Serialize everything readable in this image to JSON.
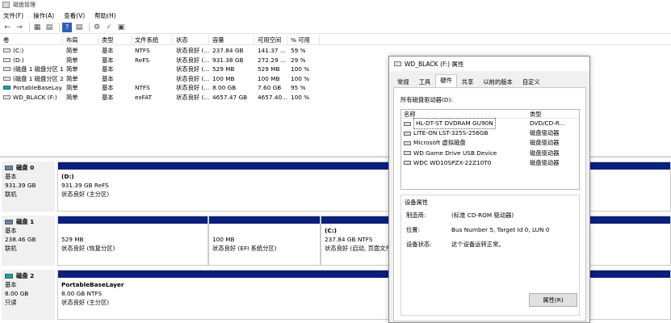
{
  "window": {
    "title": "磁盘管理"
  },
  "menu": [
    "文件(F)",
    "操作(A)",
    "查看(V)",
    "帮助(H)"
  ],
  "volume_table": {
    "columns": [
      "卷",
      "布局",
      "类型",
      "文件系统",
      "状态",
      "容量",
      "可用空间",
      "% 可用"
    ],
    "rows": [
      [
        "(C:)",
        "简单",
        "基本",
        "NTFS",
        "状态良好 (...",
        "237.84 GB",
        "141.37 ...",
        "59 %"
      ],
      [
        "(D:)",
        "简单",
        "基本",
        "ReFS",
        "状态良好 (...",
        "931.38 GB",
        "272.29 ...",
        "29 %"
      ],
      [
        "(磁盘 1 磁盘分区 1)",
        "简单",
        "基本",
        "",
        "状态良好 (...",
        "529 MB",
        "529 MB",
        "100 %"
      ],
      [
        "(磁盘 1 磁盘分区 2)",
        "简单",
        "基本",
        "",
        "状态良好 (...",
        "100 MB",
        "100 MB",
        "100 %"
      ],
      [
        "PortableBaseLay...",
        "简单",
        "基本",
        "NTFS",
        "状态良好 (...",
        "8.00 GB",
        "7.60 GB",
        "95 %"
      ],
      [
        "WD_BLACK (F:)",
        "简单",
        "基本",
        "exFAT",
        "状态良好 (...",
        "4657.47 GB",
        "4657.40...",
        "100 %"
      ]
    ]
  },
  "disks": [
    {
      "name": "磁盘 0",
      "type": "基本",
      "size": "931.39 GB",
      "status": "联机",
      "partitions": [
        {
          "title": "(D:)",
          "line1": "931.39 GB ReFS",
          "line2": "状态良好 (主分区)"
        }
      ]
    },
    {
      "name": "磁盘 1",
      "type": "基本",
      "size": "238.46 GB",
      "status": "联机",
      "partitions": [
        {
          "title": "",
          "line1": "529 MB",
          "line2": "状态良好 (恢复分区)"
        },
        {
          "title": "",
          "line1": "100 MB",
          "line2": "状态良好 (EFI 系统分区)"
        },
        {
          "title": "(C:)",
          "line1": "237.84 GB NTFS",
          "line2": "状态良好 (启动, 页面文件"
        }
      ]
    },
    {
      "name": "磁盘 2",
      "type": "基本",
      "size": "8.00 GB",
      "status": "只读",
      "partitions": [
        {
          "title": "PortableBaseLayer",
          "line1": "8.00 GB NTFS",
          "line2": "状态良好 (主分区)"
        }
      ]
    }
  ],
  "dialog": {
    "title": "WD_BLACK (F:) 属性",
    "tabs": [
      "常规",
      "工具",
      "硬件",
      "共享",
      "以前的版本",
      "自定义"
    ],
    "active_tab": "硬件",
    "all_drives_label": "所有磁盘驱动器(D):",
    "list_headers": [
      "名称",
      "类型"
    ],
    "devices": [
      {
        "name": "HL-DT-ST DVDRAM GU90N",
        "type": "DVD/CD-R..."
      },
      {
        "name": "LITE-ON LST-325S-256GB",
        "type": "磁盘驱动器"
      },
      {
        "name": "Microsoft 虚拟磁盘",
        "type": "磁盘驱动器"
      },
      {
        "name": "WD Game Drive USB Device",
        "type": "磁盘驱动器"
      },
      {
        "name": "WDC WD10SPZX-22Z10T0",
        "type": "磁盘驱动器"
      }
    ],
    "properties_title": "设备属性",
    "props": [
      {
        "k": "制造商:",
        "v": "(标准 CD-ROM 驱动器)"
      },
      {
        "k": "位置:",
        "v": "Bus Number 5, Target Id 0, LUN 0"
      },
      {
        "k": "设备状态:",
        "v": "这个设备运转正常。"
      }
    ],
    "properties_button": "属性(R)"
  }
}
